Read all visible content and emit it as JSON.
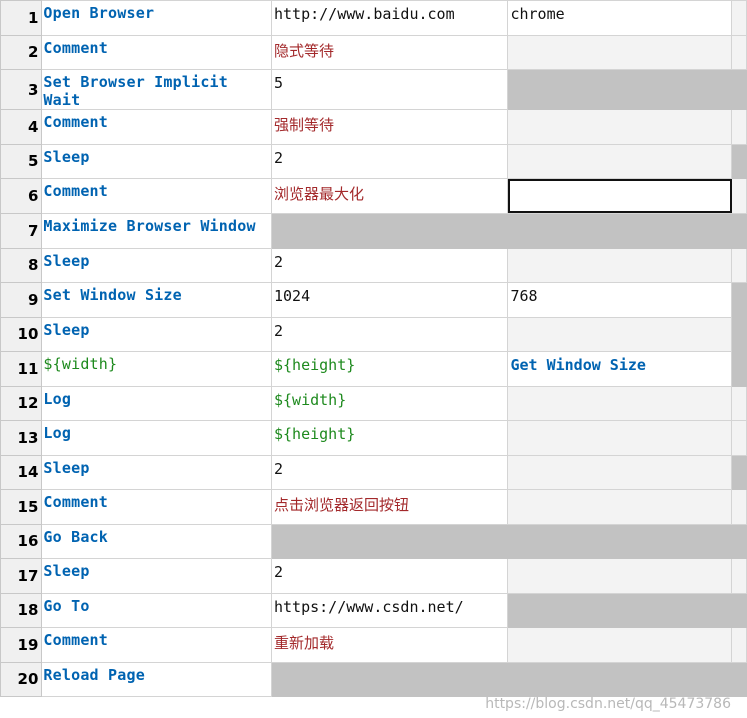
{
  "rows": [
    {
      "num": "1",
      "keyword": "Open Browser",
      "arg1": "http://www.baidu.com",
      "arg2": "chrome"
    },
    {
      "num": "2",
      "keyword": "Comment",
      "arg1": "隐式等待",
      "arg2": ""
    },
    {
      "num": "3",
      "keyword": "Set Browser Implicit Wait",
      "arg1": "5",
      "arg2": ""
    },
    {
      "num": "4",
      "keyword": "Comment",
      "arg1": "强制等待",
      "arg2": ""
    },
    {
      "num": "5",
      "keyword": "Sleep",
      "arg1": "2",
      "arg2": ""
    },
    {
      "num": "6",
      "keyword": "Comment",
      "arg1": "浏览器最大化",
      "arg2": ""
    },
    {
      "num": "7",
      "keyword": "Maximize Browser Window",
      "arg1": "",
      "arg2": ""
    },
    {
      "num": "8",
      "keyword": "Sleep",
      "arg1": "2",
      "arg2": ""
    },
    {
      "num": "9",
      "keyword": "Set Window Size",
      "arg1": "1024",
      "arg2": "768"
    },
    {
      "num": "10",
      "keyword": "Sleep",
      "arg1": "2",
      "arg2": ""
    },
    {
      "num": "11",
      "keyword": "${width}",
      "arg1": "${height}",
      "arg2": "Get Window Size"
    },
    {
      "num": "12",
      "keyword": "Log",
      "arg1": "${width}",
      "arg2": ""
    },
    {
      "num": "13",
      "keyword": "Log",
      "arg1": "${height}",
      "arg2": ""
    },
    {
      "num": "14",
      "keyword": "Sleep",
      "arg1": "2",
      "arg2": ""
    },
    {
      "num": "15",
      "keyword": "Comment",
      "arg1": "点击浏览器返回按钮",
      "arg2": ""
    },
    {
      "num": "16",
      "keyword": "Go Back",
      "arg1": "",
      "arg2": ""
    },
    {
      "num": "17",
      "keyword": "Sleep",
      "arg1": "2",
      "arg2": ""
    },
    {
      "num": "18",
      "keyword": "Go To",
      "arg1": "https://www.csdn.net/",
      "arg2": ""
    },
    {
      "num": "19",
      "keyword": "Comment",
      "arg1": "重新加载",
      "arg2": ""
    },
    {
      "num": "20",
      "keyword": "Reload Page",
      "arg1": "",
      "arg2": ""
    }
  ],
  "watermark": "https://blog.csdn.net/qq_45473786",
  "colors": {
    "keyword": "#0063b1",
    "variable": "#1e8a1e",
    "comment": "#a3292b",
    "disabled_cell": "#c2c2c2"
  }
}
